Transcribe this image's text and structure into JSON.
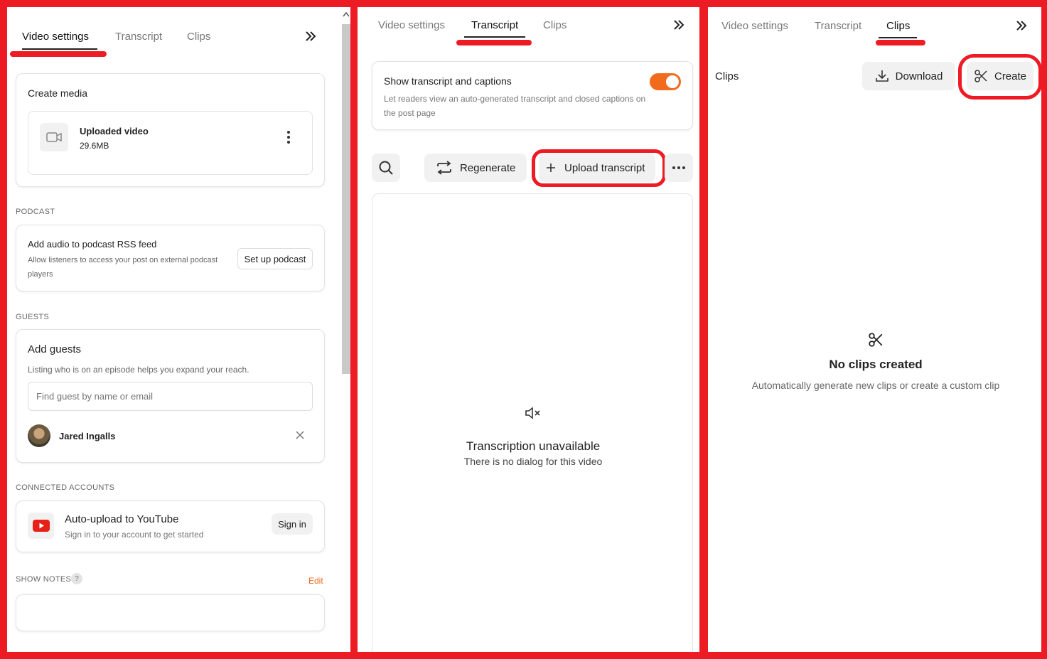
{
  "colors": {
    "accent": "#f26b1d",
    "annotation": "#ed1c24",
    "youtube": "#e62117"
  },
  "tabs": {
    "video_settings": "Video settings",
    "transcript": "Transcript",
    "clips": "Clips"
  },
  "panel1": {
    "create_media": {
      "title": "Create media",
      "file_name": "Uploaded video",
      "file_size": "29.6MB",
      "icon": "video-camera-icon"
    },
    "podcast": {
      "section": "PODCAST",
      "title": "Add audio to podcast RSS feed",
      "description_line1": "Allow listeners to access your post on external podcast",
      "description_line2": "players",
      "button": "Set up podcast"
    },
    "guests": {
      "section": "GUESTS",
      "title": "Add guests",
      "description": "Listing who is on an episode helps you expand your reach.",
      "placeholder": "Find guest by name or email",
      "guest_name": "Jared Ingalls"
    },
    "connected": {
      "section": "CONNECTED ACCOUNTS",
      "title": "Auto-upload to YouTube",
      "description": "Sign in to your account to get started",
      "button": "Sign in"
    },
    "show_notes": {
      "section": "SHOW NOTES",
      "help": "?",
      "edit": "Edit"
    }
  },
  "panel2": {
    "captions": {
      "title": "Show transcript and captions",
      "description_line1": "Let readers view an auto-generated transcript and closed captions on",
      "description_line2": "the post page",
      "enabled": true
    },
    "toolbar": {
      "regenerate": "Regenerate",
      "upload": "Upload transcript"
    },
    "empty": {
      "title": "Transcription unavailable",
      "subtitle": "There is no dialog for this video"
    }
  },
  "panel3": {
    "header": "Clips",
    "download": "Download",
    "create": "Create",
    "empty": {
      "title": "No clips created",
      "subtitle": "Automatically generate new clips or create a custom clip"
    }
  }
}
